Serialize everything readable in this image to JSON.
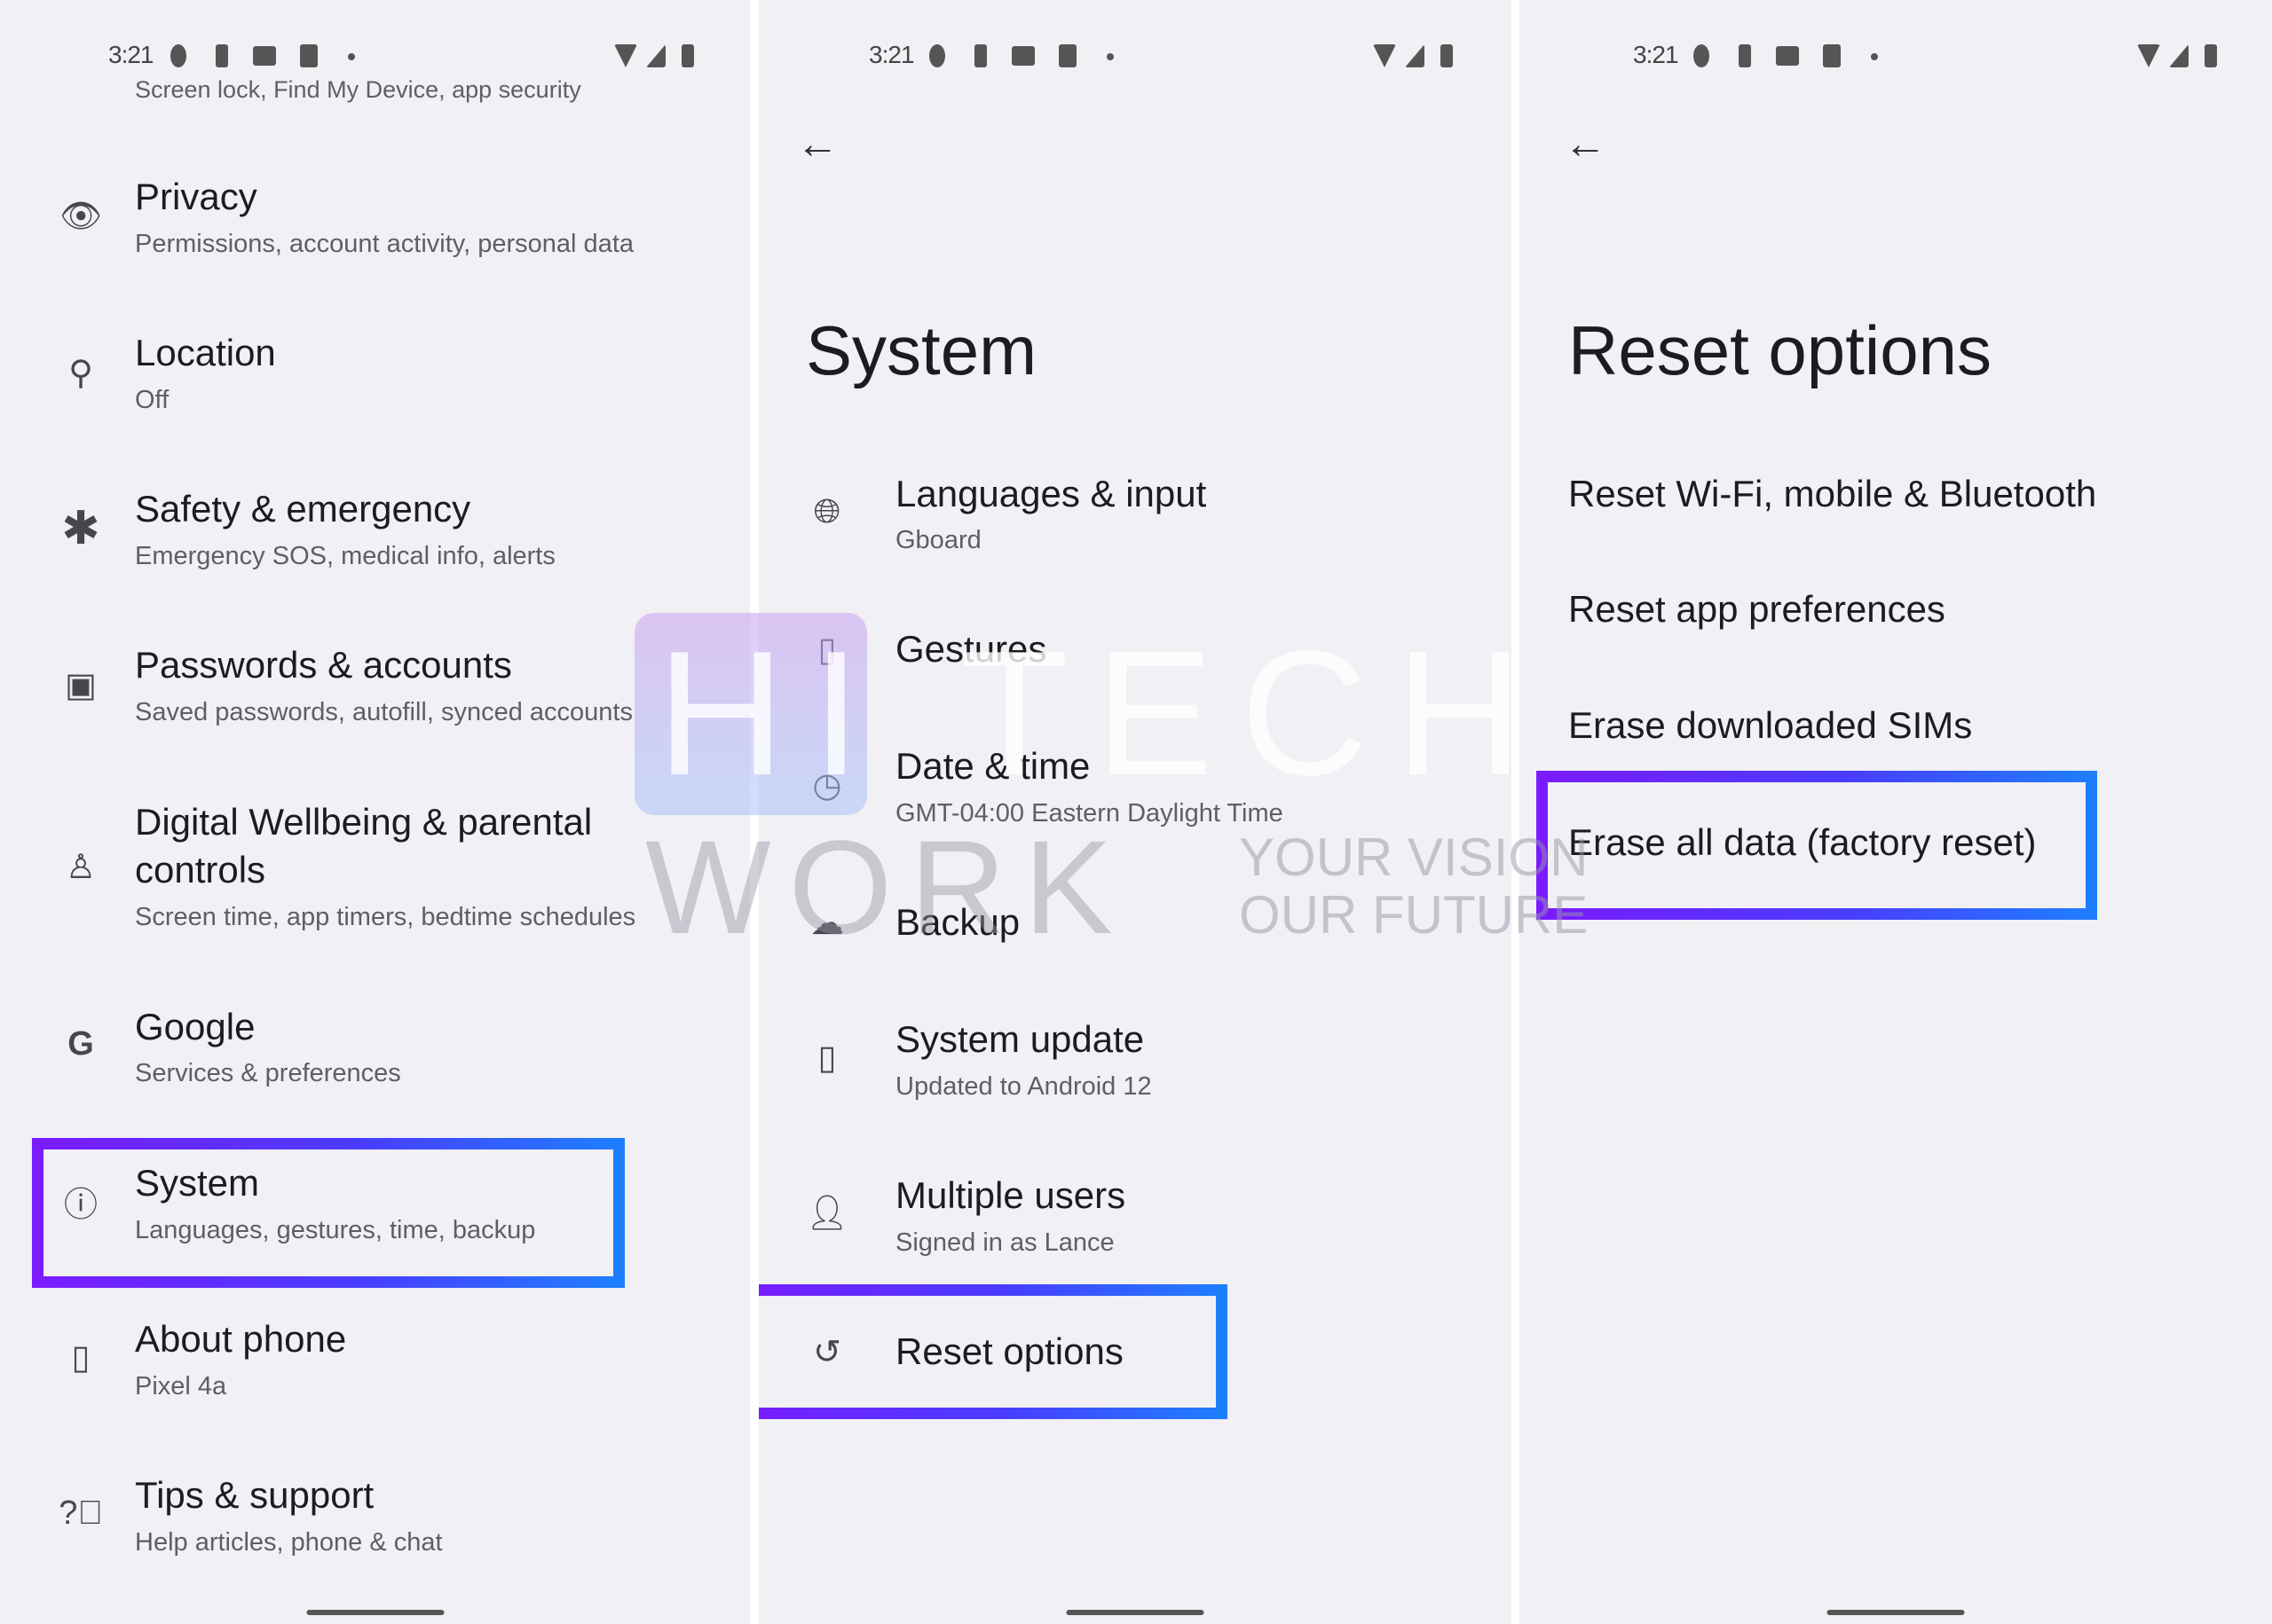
{
  "status_bar": {
    "time": "3:21"
  },
  "panel1": {
    "cut_off_text": "Screen lock, Find My Device, app security",
    "items": [
      {
        "title": "Privacy",
        "subtitle": "Permissions, account activity, personal data",
        "icon": "privacy-eye-lock-icon"
      },
      {
        "title": "Location",
        "subtitle": "Off",
        "icon": "location-pin-icon"
      },
      {
        "title": "Safety & emergency",
        "subtitle": "Emergency SOS, medical info, alerts",
        "icon": "asterisk-icon"
      },
      {
        "title": "Passwords & accounts",
        "subtitle": "Saved passwords, autofill, synced accounts",
        "icon": "account-box-icon"
      },
      {
        "title": "Digital Wellbeing & parental",
        "title2": "controls",
        "subtitle": "Screen time, app timers, bedtime schedules",
        "icon": "wellbeing-icon"
      },
      {
        "title": "Google",
        "subtitle": "Services & preferences",
        "icon": "google-g-icon"
      },
      {
        "title": "System",
        "subtitle": "Languages, gestures, time, backup",
        "icon": "info-icon"
      },
      {
        "title": "About phone",
        "subtitle": "Pixel 4a",
        "icon": "phone-icon"
      },
      {
        "title": "Tips & support",
        "subtitle": "Help articles, phone & chat",
        "icon": "help-icon"
      }
    ]
  },
  "panel2": {
    "title": "System",
    "items": [
      {
        "title": "Languages & input",
        "subtitle": "Gboard",
        "icon": "globe-icon"
      },
      {
        "title": "Gestures",
        "subtitle": "",
        "icon": "gesture-phone-icon"
      },
      {
        "title": "Date & time",
        "subtitle": "GMT-04:00 Eastern Daylight Time",
        "icon": "clock-icon"
      },
      {
        "title": "Backup",
        "subtitle": "",
        "icon": "cloud-upload-icon"
      },
      {
        "title": "System update",
        "subtitle": "Updated to Android 12",
        "icon": "system-update-icon"
      },
      {
        "title": "Multiple users",
        "subtitle": "Signed in as Lance",
        "icon": "person-icon"
      },
      {
        "title": "Reset options",
        "subtitle": "",
        "icon": "history-icon"
      }
    ]
  },
  "panel3": {
    "title": "Reset options",
    "items": [
      "Reset Wi-Fi, mobile & Bluetooth",
      "Reset app preferences",
      "Erase downloaded SIMs",
      "Erase all data (factory reset)"
    ]
  },
  "watermark": {
    "line1": "HI TECH",
    "line2": "WORK",
    "tagline1": "YOUR VISION",
    "tagline2": "OUR FUTURE"
  },
  "colors": {
    "background": "#f1f0f4",
    "highlight_start": "#7a1cff",
    "highlight_end": "#1f7dff"
  }
}
